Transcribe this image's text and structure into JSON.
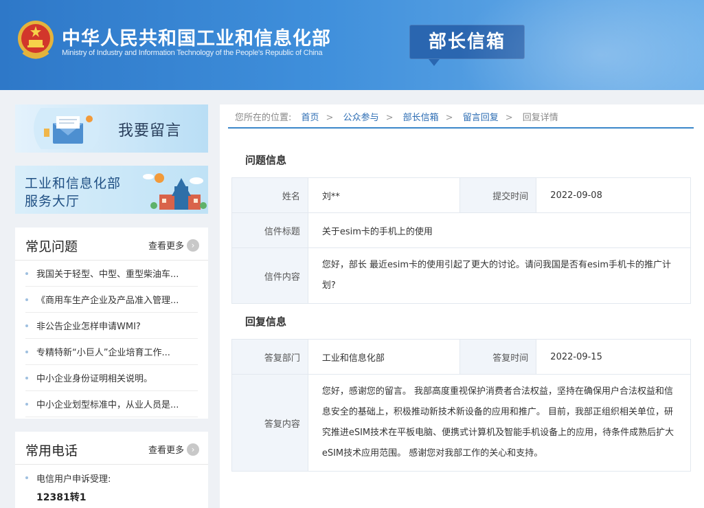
{
  "header": {
    "title": "中华人民共和国工业和信息化部",
    "subtitle": "Ministry of Industry and Information Technology of the People's Republic of China",
    "badge": "部长信箱"
  },
  "sidebar": {
    "banner_message": "我要留言",
    "banner_service_line1": "工业和信息化部",
    "banner_service_line2": "服务大厅",
    "faq": {
      "title": "常见问题",
      "more": "查看更多",
      "items": [
        "我国关于轻型、中型、重型柴油车...",
        "《商用车生产企业及产品准入管理...",
        "非公告企业怎样申请WMI?",
        "专精特新“小巨人”企业培育工作...",
        "中小企业身份证明相关说明。",
        "中小企业划型标准中，从业人员是..."
      ]
    },
    "phones": {
      "title": "常用电话",
      "more": "查看更多",
      "items": [
        {
          "label": "电信用户申诉受理:",
          "number": "12381转1"
        }
      ]
    }
  },
  "breadcrumb": {
    "prefix": "您所在的位置:",
    "items": [
      "首页",
      "公众参与",
      "部长信箱",
      "留言回复"
    ],
    "current": "回复详情"
  },
  "question": {
    "section_title": "问题信息",
    "name_label": "姓名",
    "name": "刘**",
    "submit_time_label": "提交时间",
    "submit_time": "2022-09-08",
    "subject_label": "信件标题",
    "subject": "关于esim卡的手机上的使用",
    "content_label": "信件内容",
    "content": "您好，部长 最近esim卡的使用引起了更大的讨论。请问我国是否有esim手机卡的推广计划?"
  },
  "reply": {
    "section_title": "回复信息",
    "dept_label": "答复部门",
    "dept": "工业和信息化部",
    "time_label": "答复时间",
    "time": "2022-09-15",
    "content_label": "答复内容",
    "content": "您好，感谢您的留言。 我部高度重视保护消费者合法权益，坚持在确保用户合法权益和信息安全的基础上，积极推动新技术新设备的应用和推广。 目前，我部正组织相关单位，研究推进eSIM技术在平板电脑、便携式计算机及智能手机设备上的应用，待条件成熟后扩大eSIM技术应用范围。 感谢您对我部工作的关心和支持。"
  },
  "colors": {
    "header_blue": "#2e78c8",
    "badge_blue": "#2a66b0",
    "link_blue": "#2b6cb3",
    "label_bg": "#f1f5fa"
  }
}
